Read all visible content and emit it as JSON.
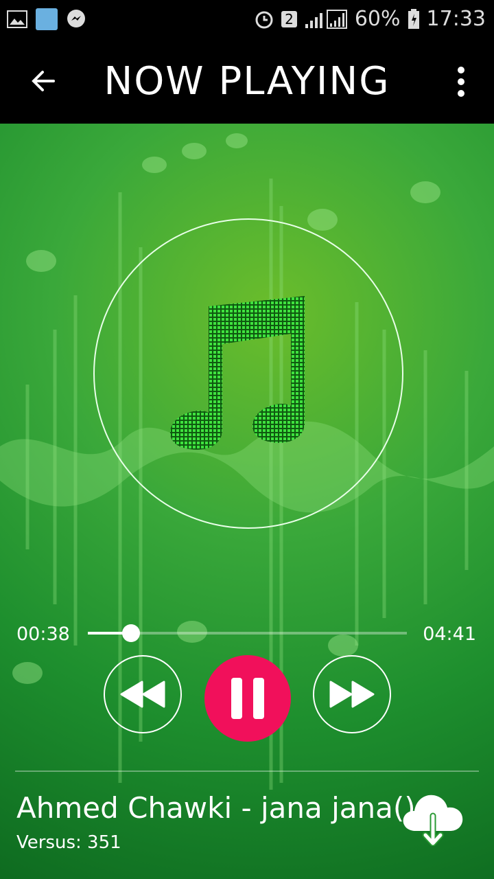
{
  "status": {
    "battery": "60%",
    "time": "17:33",
    "sim": "2"
  },
  "appbar": {
    "title": "NOW PLAYING"
  },
  "player": {
    "elapsed": "00:38",
    "duration": "04:41",
    "progress": 0.135
  },
  "track": {
    "name": "Ahmed Chawki - jana jana()",
    "versus": "Versus: 351"
  },
  "icons": [
    "image-icon",
    "avatar",
    "messenger-icon",
    "alarm-icon",
    "signal-icon",
    "battery-icon",
    "back-arrow-icon",
    "more-vert-icon",
    "music-note-icon",
    "rewind-icon",
    "pause-icon",
    "fast-forward-icon",
    "cloud-download-icon"
  ],
  "colors": {
    "accent": "#f1105b",
    "background": "#2e9f35"
  }
}
